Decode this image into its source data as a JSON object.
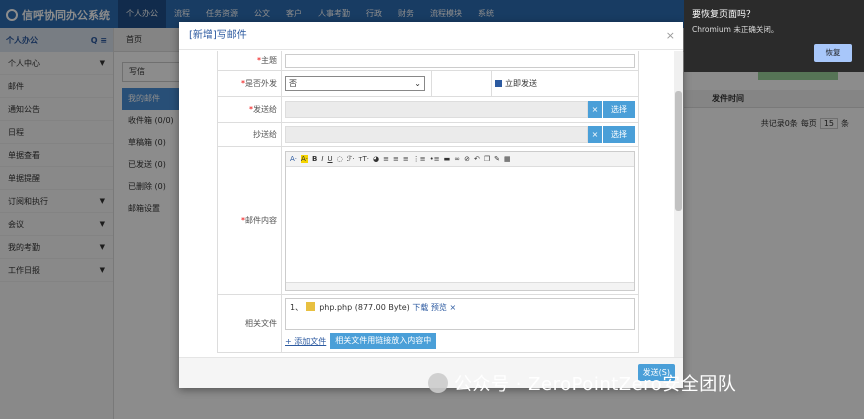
{
  "app": {
    "title": "信呼协同办公系统"
  },
  "topnav": [
    "个人办公",
    "流程",
    "任务资源",
    "公文",
    "客户",
    "人事考勤",
    "行政",
    "财务",
    "流程模块",
    "系统"
  ],
  "sidebar": {
    "header": "个人办公",
    "items": [
      "个人中心",
      "邮件",
      "通知公告",
      "日程",
      "单据查看",
      "单据提醒",
      "订阅和执行",
      "会议",
      "我的考勤",
      "工作日报"
    ]
  },
  "tabs": [
    "首页"
  ],
  "mailnav": {
    "write": "写信",
    "items": [
      "我的邮件",
      "收件箱 (0/0)",
      "草稿箱 (0)",
      "已发送 (0)",
      "已删除 (0)",
      "邮箱设置"
    ]
  },
  "grid": {
    "col_send_time": "发件时间",
    "pager_total": "共记录0条",
    "pager_per": "每页",
    "pager_num": "15",
    "pager_unit": "条"
  },
  "modal": {
    "title": "[新增]写邮件",
    "close": "×",
    "labels": {
      "subject": "主题",
      "external": "是否外发",
      "to": "发送给",
      "cc": "抄送给",
      "content": "邮件内容",
      "files": "相关文件"
    },
    "external_value": "否",
    "send_now_label": "立即发送",
    "x_label": "×",
    "choose_label": "选择",
    "file": {
      "index": "1、",
      "name": "php.php (877.00 Byte)",
      "download": "下载",
      "preview": "预览",
      "remove": "×"
    },
    "add_file": "+ 添加文件",
    "insert_file": "相关文件用链接放入内容中",
    "send_button": "发送(S)"
  },
  "popup": {
    "title": "要恢复页面吗？",
    "message": "Chromium 未正确关闭。",
    "restore": "恢复"
  },
  "watermark": {
    "text": "公众号 · ZeroPointZero安全团队"
  }
}
